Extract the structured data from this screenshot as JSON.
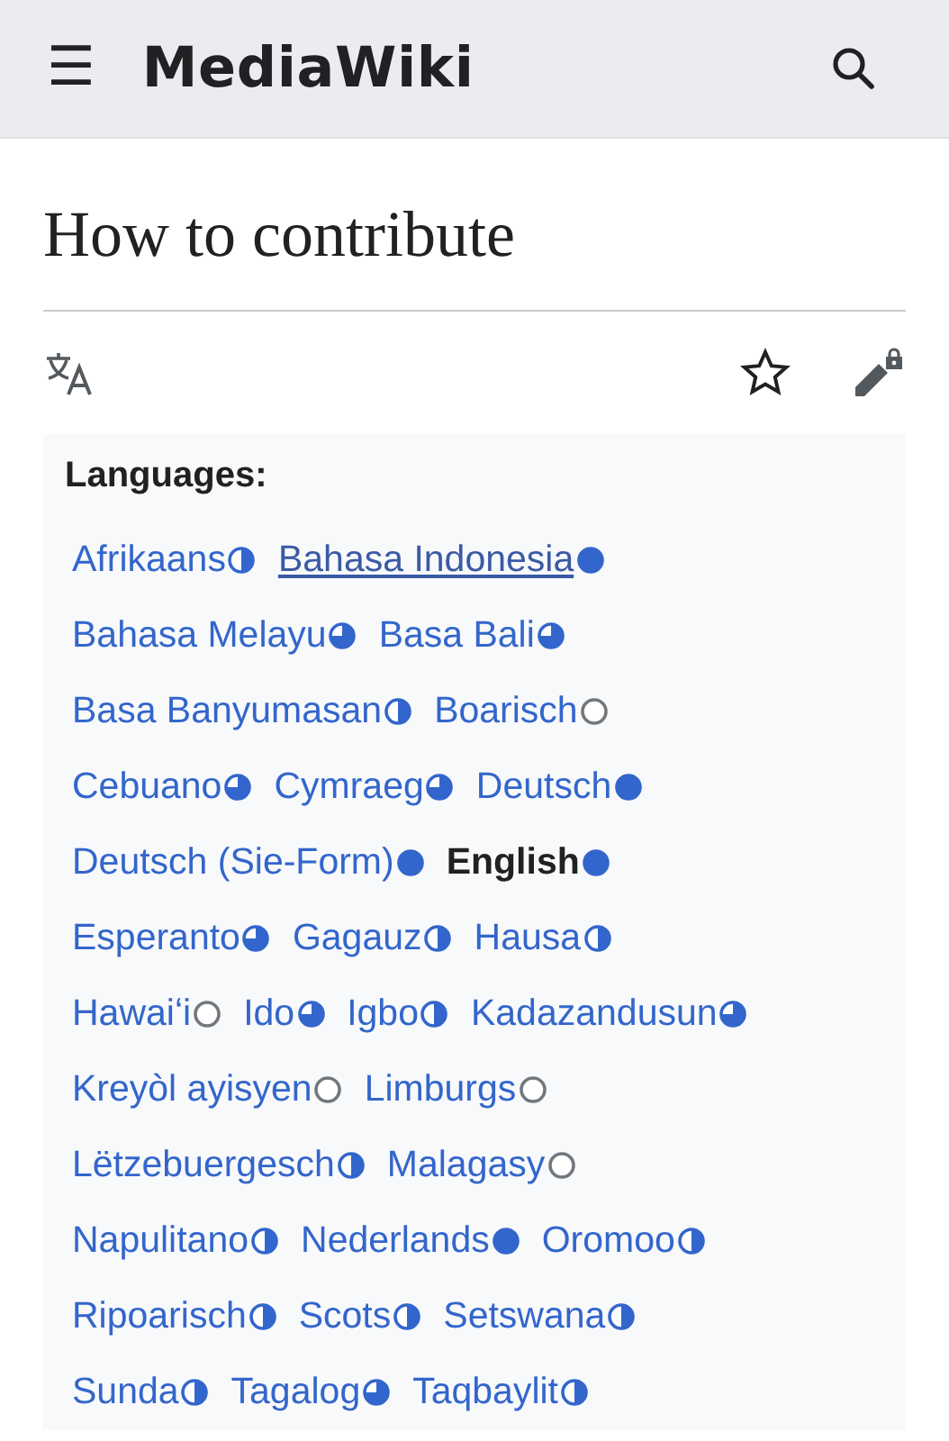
{
  "header": {
    "menu": "☰",
    "site_name": "MediaWiki"
  },
  "page": {
    "title": "How to contribute"
  },
  "languages": {
    "heading": "Languages:",
    "rows": [
      [
        {
          "name": "Afrikaans",
          "kind": "half",
          "selected": false,
          "hovered": false
        },
        {
          "name": "Bahasa Indonesia",
          "kind": "full",
          "selected": false,
          "hovered": true
        }
      ],
      [
        {
          "name": "Bahasa Melayu",
          "kind": "most",
          "selected": false,
          "hovered": false
        },
        {
          "name": "Basa Bali",
          "kind": "most",
          "selected": false,
          "hovered": false
        }
      ],
      [
        {
          "name": "Basa Banyumasan",
          "kind": "half",
          "selected": false,
          "hovered": false
        },
        {
          "name": "Boarisch",
          "kind": "empty",
          "selected": false,
          "hovered": false
        }
      ],
      [
        {
          "name": "Cebuano",
          "kind": "most",
          "selected": false,
          "hovered": false
        },
        {
          "name": "Cymraeg",
          "kind": "most",
          "selected": false,
          "hovered": false
        },
        {
          "name": "Deutsch",
          "kind": "full",
          "selected": false,
          "hovered": false
        }
      ],
      [
        {
          "name": "Deutsch (Sie-Form)",
          "kind": "full",
          "selected": false,
          "hovered": false
        },
        {
          "name": "English",
          "kind": "full",
          "selected": true,
          "hovered": false
        }
      ],
      [
        {
          "name": "Esperanto",
          "kind": "most",
          "selected": false,
          "hovered": false
        },
        {
          "name": "Gagauz",
          "kind": "half",
          "selected": false,
          "hovered": false
        },
        {
          "name": "Hausa",
          "kind": "half",
          "selected": false,
          "hovered": false
        }
      ],
      [
        {
          "name": "Hawaiʻi",
          "kind": "empty",
          "selected": false,
          "hovered": false
        },
        {
          "name": "Ido",
          "kind": "most",
          "selected": false,
          "hovered": false
        },
        {
          "name": "Igbo",
          "kind": "half",
          "selected": false,
          "hovered": false
        },
        {
          "name": "Kadazandusun",
          "kind": "most",
          "selected": false,
          "hovered": false
        }
      ],
      [
        {
          "name": "Kreyòl ayisyen",
          "kind": "empty",
          "selected": false,
          "hovered": false
        },
        {
          "name": "Limburgs",
          "kind": "empty",
          "selected": false,
          "hovered": false
        }
      ],
      [
        {
          "name": "Lëtzebuergesch",
          "kind": "half",
          "selected": false,
          "hovered": false
        },
        {
          "name": "Malagasy",
          "kind": "empty",
          "selected": false,
          "hovered": false
        }
      ],
      [
        {
          "name": "Napulitano",
          "kind": "half",
          "selected": false,
          "hovered": false
        },
        {
          "name": "Nederlands",
          "kind": "full",
          "selected": false,
          "hovered": false
        },
        {
          "name": "Oromoo",
          "kind": "half",
          "selected": false,
          "hovered": false
        }
      ],
      [
        {
          "name": "Ripoarisch",
          "kind": "half",
          "selected": false,
          "hovered": false
        },
        {
          "name": "Scots",
          "kind": "half",
          "selected": false,
          "hovered": false
        },
        {
          "name": "Setswana",
          "kind": "half",
          "selected": false,
          "hovered": false
        }
      ],
      [
        {
          "name": "Sunda",
          "kind": "half",
          "selected": false,
          "hovered": false
        },
        {
          "name": "Tagalog",
          "kind": "most",
          "selected": false,
          "hovered": false
        },
        {
          "name": "Taqbaylit",
          "kind": "half",
          "selected": false,
          "hovered": false
        }
      ]
    ]
  }
}
